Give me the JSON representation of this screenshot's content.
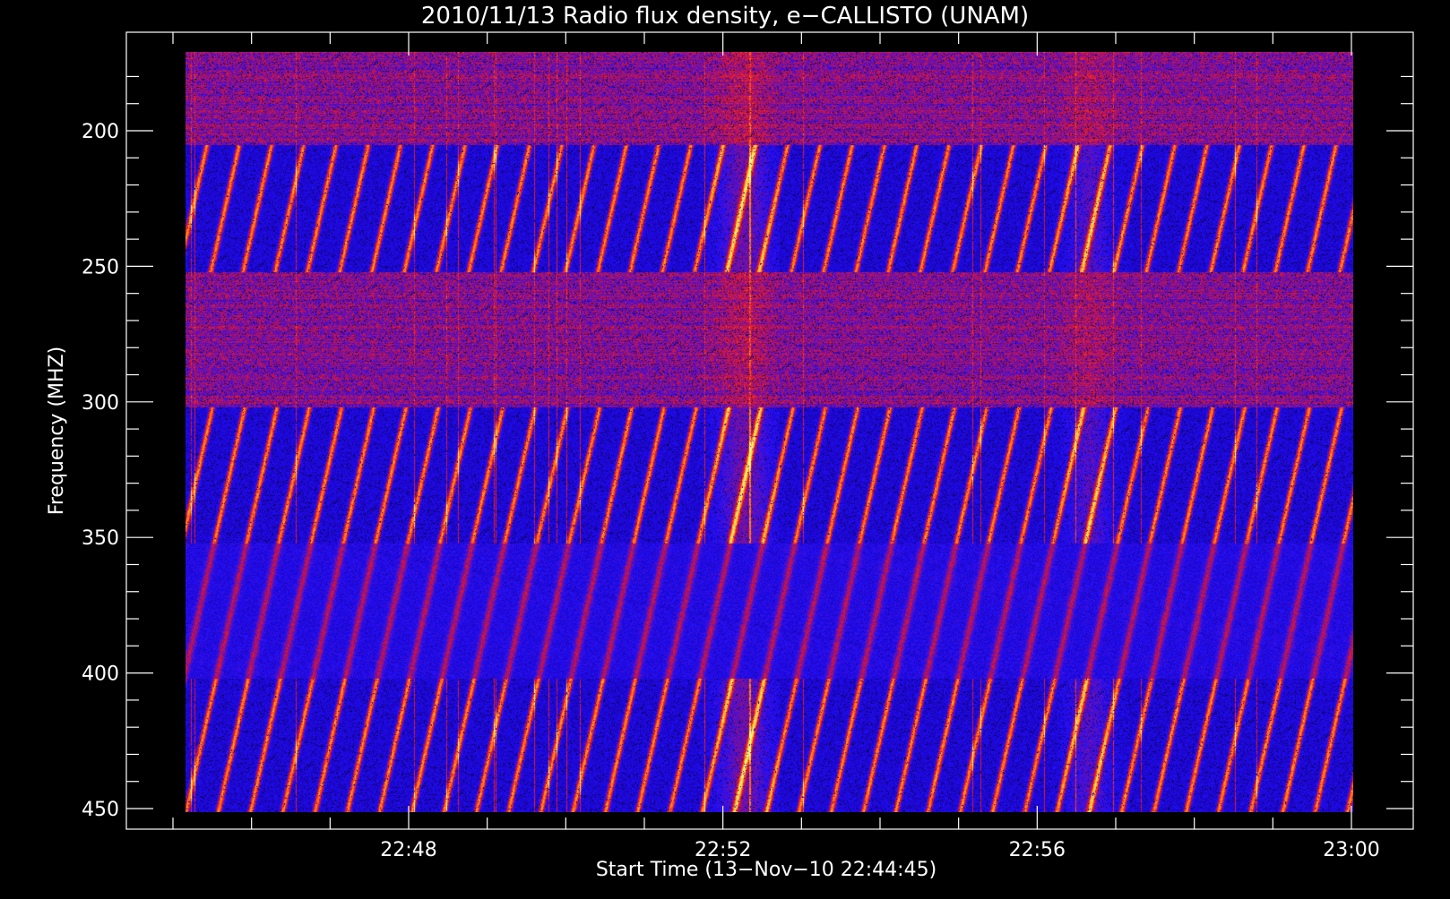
{
  "chart_data": {
    "type": "heatmap",
    "title": "2010/11/13  Radio flux density, e−CALLISTO (UNAM)",
    "xlabel": "Start Time (13−Nov−10 22:44:45)",
    "ylabel": "Frequency (MHZ)",
    "x_ticks": [
      "22:48",
      "22:52",
      "22:56",
      "23:00"
    ],
    "x_tick_minutes": [
      3.25,
      7.25,
      11.25,
      15.25
    ],
    "y_ticks": [
      200,
      250,
      300,
      350,
      400,
      450
    ],
    "ylim": [
      170,
      457
    ],
    "y_inverted": true,
    "colormap": [
      "#000000",
      "#1a00a8",
      "#2010ff",
      "#a01070",
      "#ff2010",
      "#ffa020",
      "#ffff80"
    ],
    "drift_bursts": {
      "frequency_ranges_mhz": [
        [
          210,
          250
        ],
        [
          305,
          350
        ],
        [
          405,
          450
        ]
      ],
      "intense_time_ranges": [
        "22:51–22:53",
        "22:56–22:58"
      ]
    },
    "background_color": "#000000",
    "axis_color": "#ffffff"
  }
}
